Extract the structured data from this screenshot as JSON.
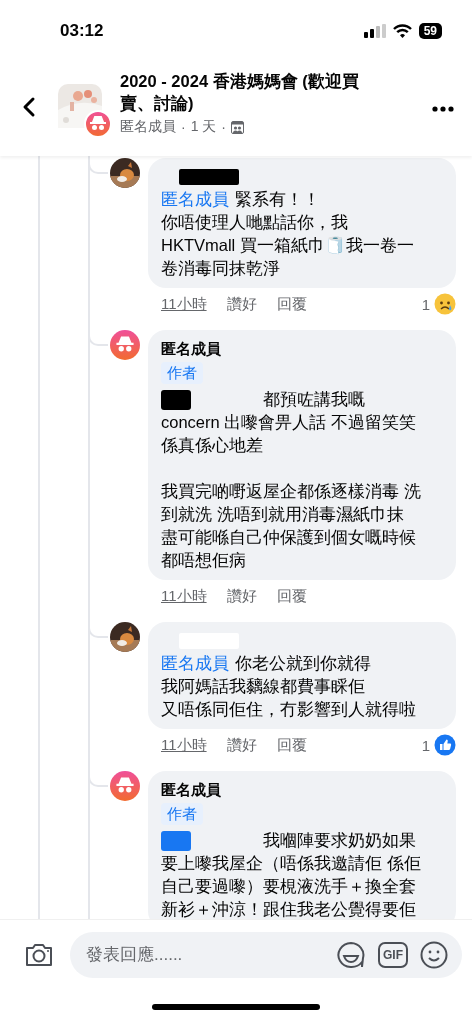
{
  "status_bar": {
    "time": "03:12",
    "battery": "59"
  },
  "header": {
    "title": "2020 - 2024 香港媽媽會 (歡迎買賣、討論)",
    "byline": [
      "匿名成員",
      "·",
      "1 天",
      "·"
    ]
  },
  "comments": [
    {
      "anonymous": false,
      "name_redaction": {
        "color": "#000000"
      },
      "mention": "匿名成員",
      "paragraphs": [
        [
          "緊系有！！",
          "你唔使理人哋點話你，我",
          "HKTVmall 買一箱紙巾🧻我一卷一",
          "卷消毒同抹乾淨"
        ]
      ],
      "time": "11小時",
      "like": "讚好",
      "reply": "回覆",
      "reaction": {
        "count": "1",
        "kind": "sad"
      }
    },
    {
      "anonymous": true,
      "author": "匿名成員",
      "badge": "作者",
      "redaction": {
        "color": "#000000"
      },
      "paragraphs": [
        [
          "都預咗講我嘅",
          "concern 出嚟會畀人話 不過留笑笑",
          "係真係心地差"
        ],
        [
          "我買完啲嘢返屋企都係逐樣消毒 洗",
          "到就洗 洗唔到就用消毒濕紙巾抹",
          "盡可能喺自己仲保護到個女嘅時候",
          "都唔想佢病"
        ]
      ],
      "time": "11小時",
      "like": "讚好",
      "reply": "回覆"
    },
    {
      "anonymous": false,
      "name_redaction": {
        "color": "#ffffff"
      },
      "mention": "匿名成員",
      "paragraphs": [
        [
          "你老公就到你就得",
          "我阿媽話我黐線都費事睬佢",
          "又唔係同佢住，冇影響到人就得啦"
        ]
      ],
      "time": "11小時",
      "like": "讚好",
      "reply": "回覆",
      "reaction": {
        "count": "1",
        "kind": "like"
      }
    },
    {
      "anonymous": true,
      "author": "匿名成員",
      "badge": "作者",
      "redaction": {
        "color": "#1877f2"
      },
      "paragraphs": [
        [
          "我嗰陣要求奶奶如果",
          "要上嚟我屋企（唔係我邀請佢 係佢",
          "自己要過嚟）要梘液洗手＋換全套",
          "新衫＋沖涼！跟住我老公覺得要佢"
        ]
      ]
    }
  ],
  "composer": {
    "placeholder": "發表回應......",
    "gif": "GIF"
  }
}
